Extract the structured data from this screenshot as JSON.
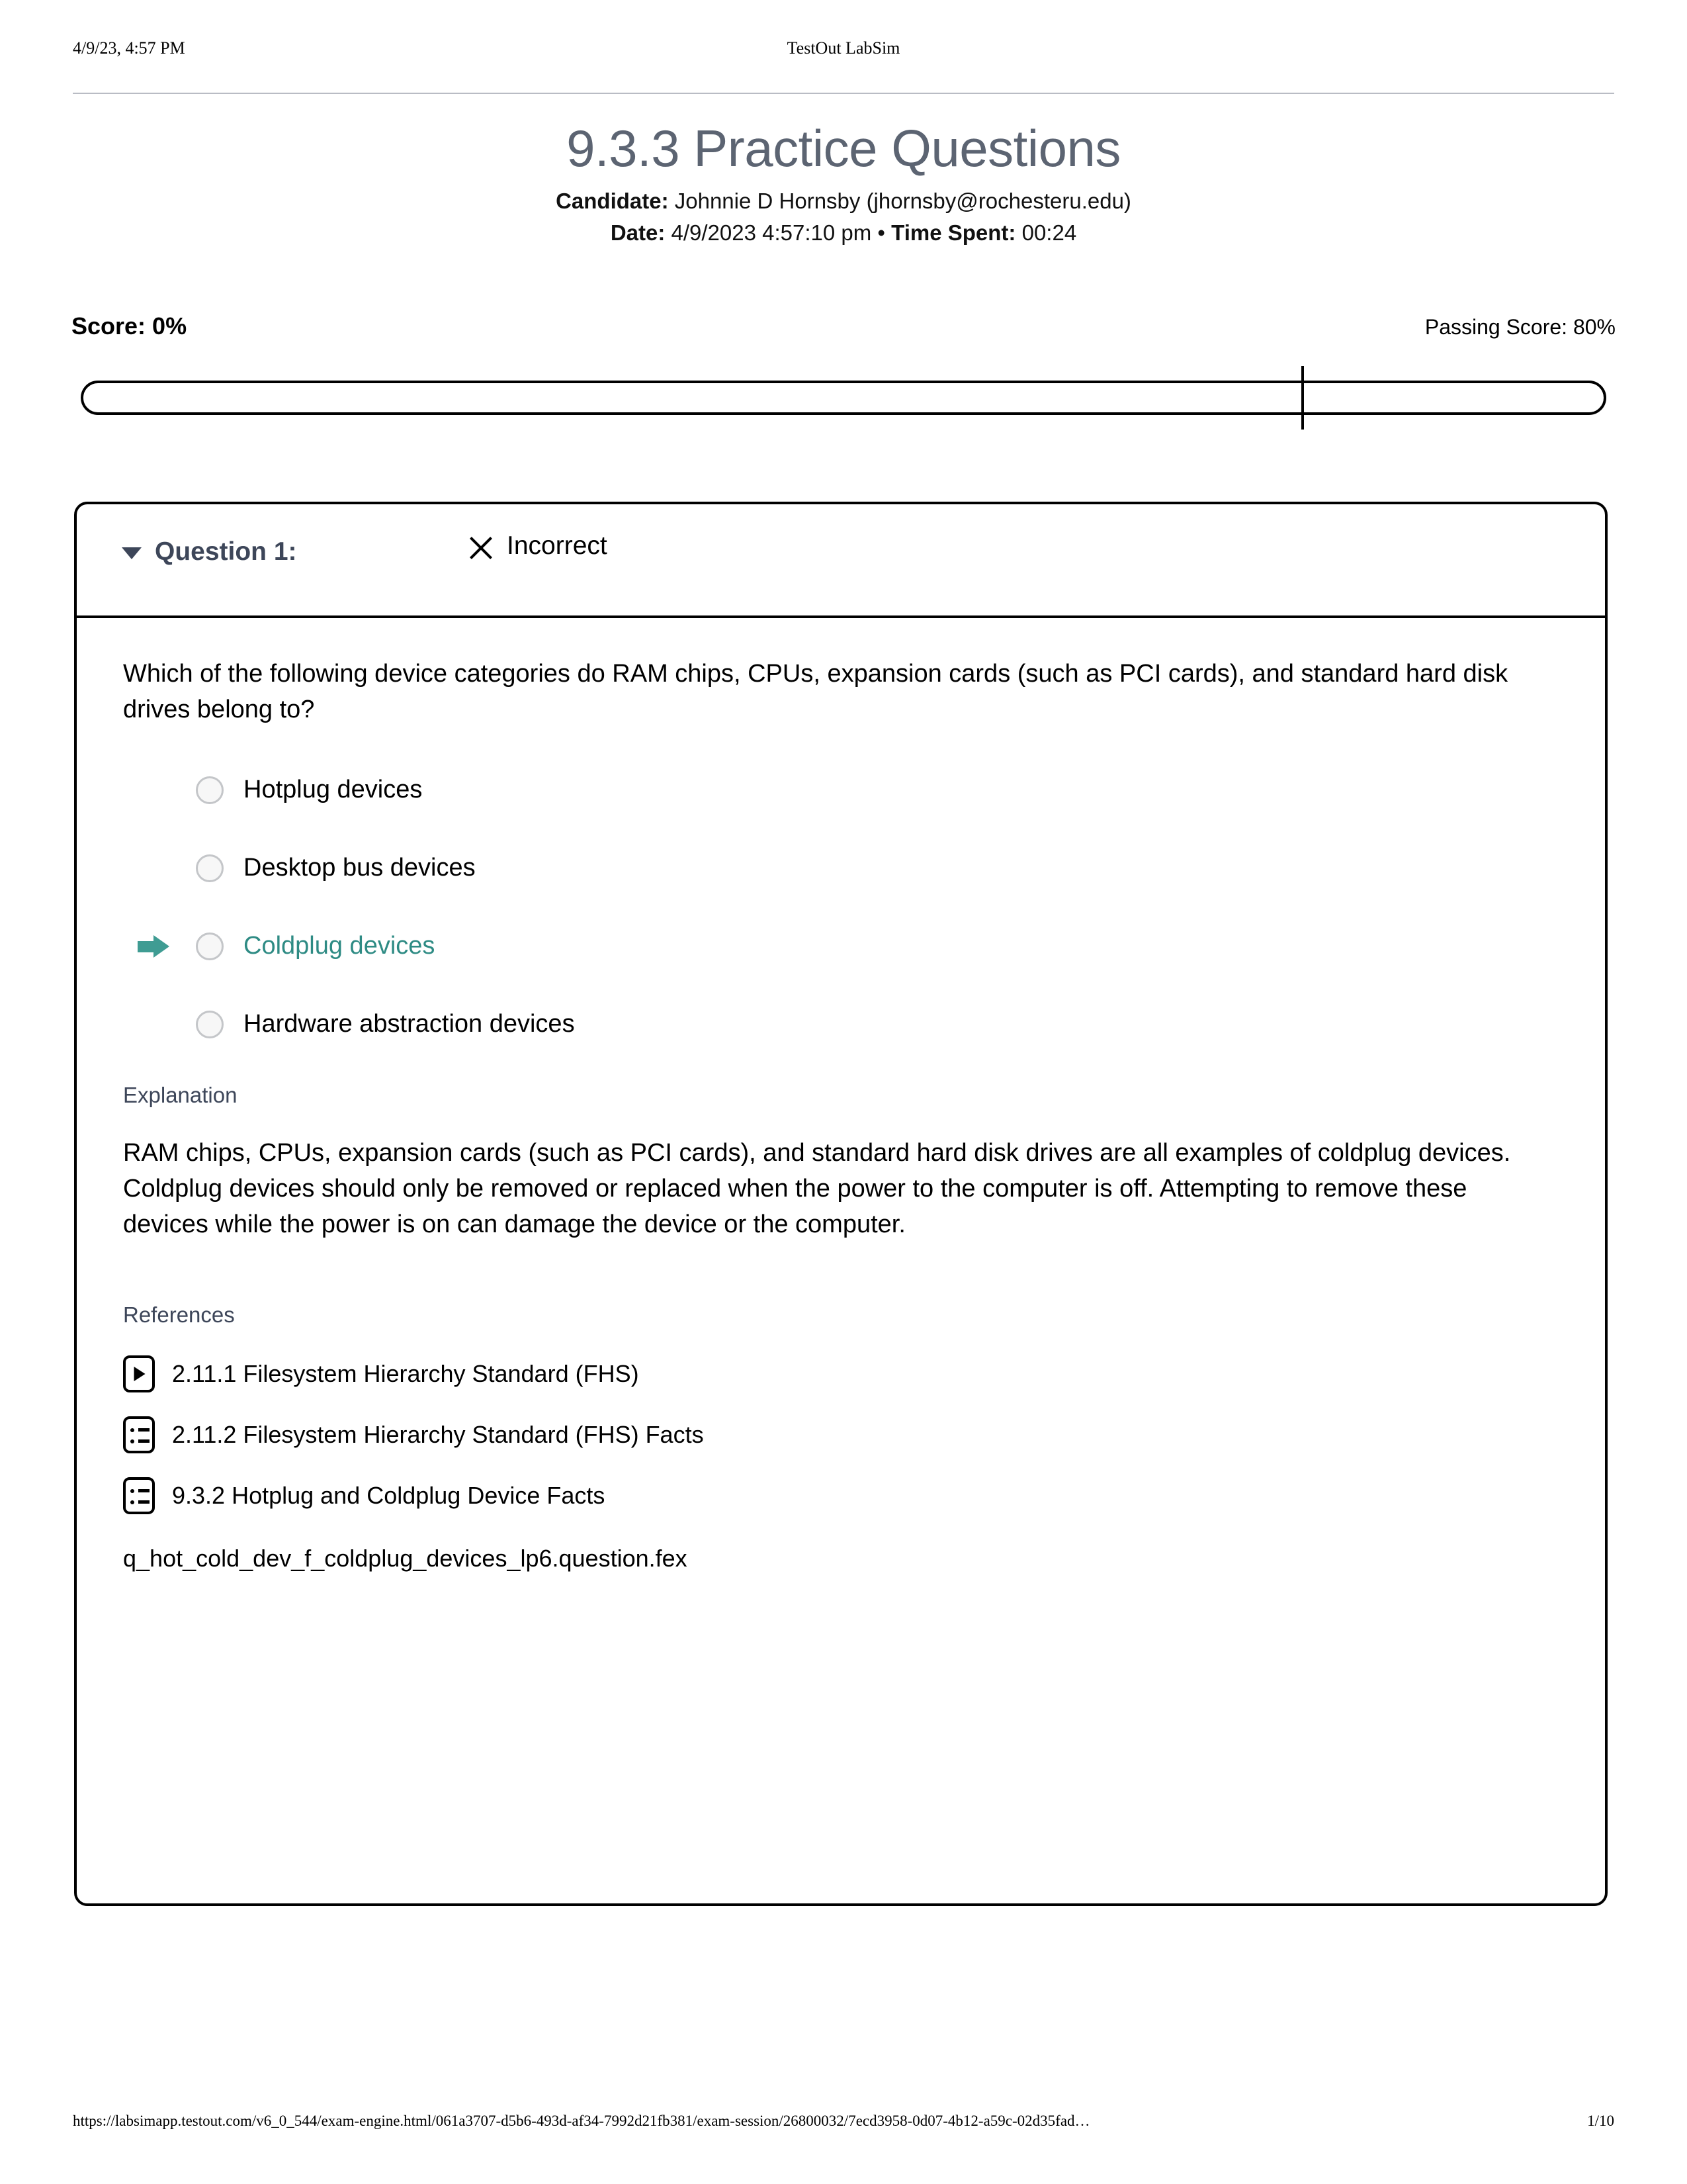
{
  "print_header": {
    "timestamp": "4/9/23, 4:57 PM",
    "app_name": "TestOut LabSim"
  },
  "title": {
    "heading": "9.3.3 Practice Questions",
    "candidate_label": "Candidate:",
    "candidate_name": "Johnnie D Hornsby  (jhornsby@rochesteru.edu)",
    "date_label": "Date:",
    "date_value": "4/9/2023 4:57:10 pm",
    "separator": " • ",
    "time_spent_label": "Time Spent:",
    "time_spent_value": "00:24"
  },
  "score": {
    "score_text": "Score: 0%",
    "passing_text": "Passing Score: 80%",
    "score_percent": 0,
    "passing_percent": 80
  },
  "question": {
    "caret_icon": "triangle-down-icon",
    "label": "Question 1:",
    "status_icon": "x-mark-icon",
    "status_text": "Incorrect",
    "prompt": "Which of the following device categories do RAM chips, CPUs, expansion cards (such as PCI cards), and standard hard disk drives belong to?",
    "options": [
      {
        "label": "Hotplug devices",
        "selected": false,
        "marked": false
      },
      {
        "label": "Desktop bus devices",
        "selected": false,
        "marked": false
      },
      {
        "label": "Coldplug devices",
        "selected": false,
        "marked": true
      },
      {
        "label": "Hardware abstraction devices",
        "selected": false,
        "marked": false
      }
    ],
    "explanation_heading": "Explanation",
    "explanation_text": "RAM chips, CPUs, expansion cards (such as PCI cards), and standard hard disk drives are all examples of coldplug devices. Coldplug devices should only be removed or replaced when the power to the computer is off. Attempting to remove these devices while the power is on can damage the device or the computer.",
    "references_heading": "References",
    "references": [
      {
        "icon": "video-play-icon",
        "label": "2.11.1 Filesystem Hierarchy Standard (FHS)"
      },
      {
        "icon": "list-facts-icon",
        "label": "2.11.2 Filesystem Hierarchy Standard (FHS) Facts"
      },
      {
        "icon": "list-facts-icon",
        "label": "9.3.2 Hotplug and Coldplug Device Facts"
      }
    ],
    "question_file": "q_hot_cold_dev_f_coldplug_devices_lp6.question.fex"
  },
  "footer": {
    "url": "https://labsimapp.testout.com/v6_0_544/exam-engine.html/061a3707-d5b6-493d-af34-7992d21fb381/exam-session/26800032/7ecd3958-0d07-4b12-a59c-02d35fad…",
    "page": "1/10"
  },
  "colors": {
    "heading_slate": "#3d4659",
    "title_gray": "#5c6472",
    "accent_teal": "#2e8b84",
    "arrow_teal": "#3f9c93"
  }
}
